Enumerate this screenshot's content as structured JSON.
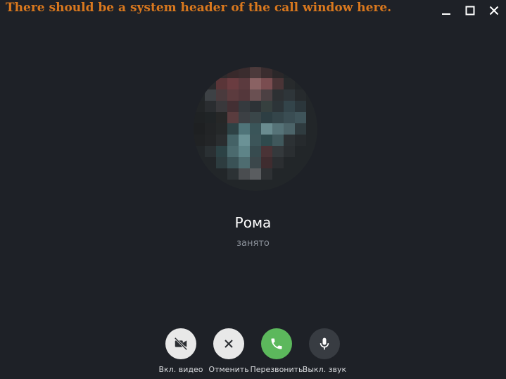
{
  "header": {
    "note": "There should be a system header of the call window here.",
    "minimize_icon": "minimize-icon",
    "maximize_icon": "maximize-icon",
    "close_icon": "close-icon"
  },
  "contact": {
    "name": "Рома",
    "status": "занято"
  },
  "controls": [
    {
      "icon": "video-off-icon",
      "label": "Вкл. видео",
      "bg": "#e8e8e8"
    },
    {
      "icon": "close-icon",
      "label": "Отменить",
      "bg": "#e8e8e8"
    },
    {
      "icon": "phone-icon",
      "label": "Перезвонить",
      "bg": "#5cb85c"
    },
    {
      "icon": "microphone-icon",
      "label": "Выкл. звук",
      "bg": "#383c42"
    }
  ],
  "colors": {
    "background": "#1e2127",
    "header_text": "#d9781e",
    "accent_green": "#5cb85c"
  }
}
